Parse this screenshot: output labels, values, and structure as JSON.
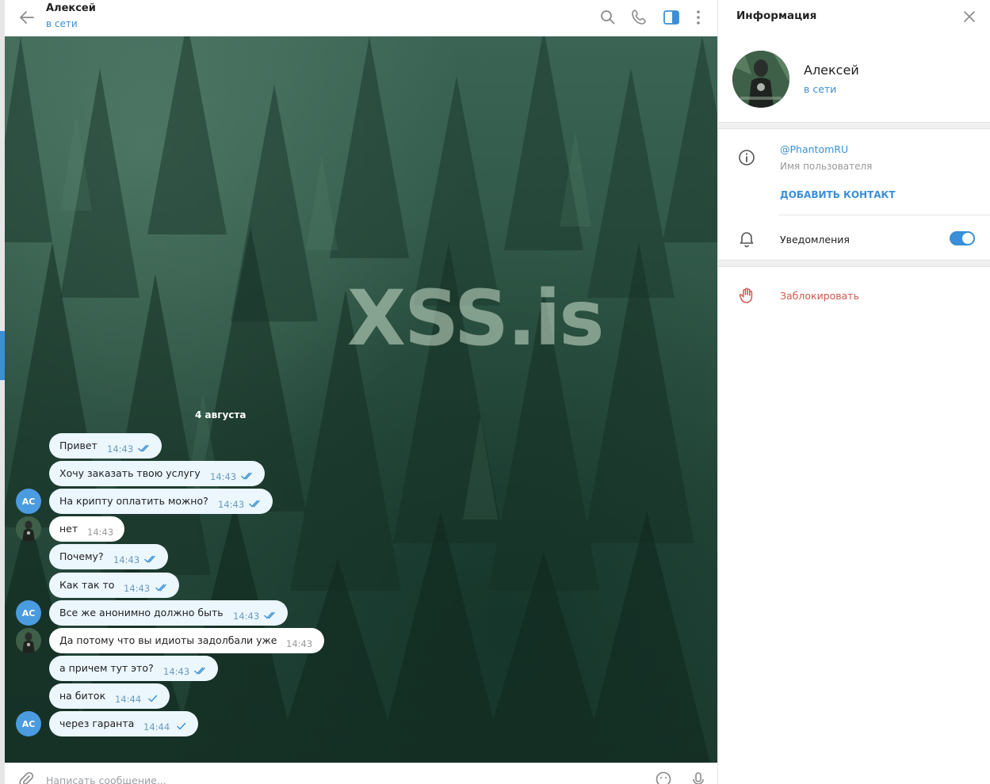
{
  "header": {
    "name": "Алексей",
    "status": "в сети"
  },
  "chat": {
    "watermark": "XSS.is",
    "date": "4 августа",
    "messages": [
      {
        "text": "Привет",
        "time": "14:43",
        "out": true,
        "check": "double",
        "avatar": ""
      },
      {
        "text": "Хочу заказать твою услугу",
        "time": "14:43",
        "out": true,
        "check": "double",
        "avatar": ""
      },
      {
        "text": "На крипту оплатить можно?",
        "time": "14:43",
        "out": true,
        "check": "double",
        "avatar": "АС"
      },
      {
        "text": "нет",
        "time": "14:43",
        "out": false,
        "check": "",
        "avatar": "photo"
      },
      {
        "text": "Почему?",
        "time": "14:43",
        "out": true,
        "check": "double",
        "avatar": ""
      },
      {
        "text": "Как так то",
        "time": "14:43",
        "out": true,
        "check": "double",
        "avatar": ""
      },
      {
        "text": "Все же анонимно должно быть",
        "time": "14:43",
        "out": true,
        "check": "double",
        "avatar": "АС"
      },
      {
        "text": "Да потому что вы идиоты задолбали уже",
        "time": "14:43",
        "out": false,
        "check": "",
        "avatar": "photo"
      },
      {
        "text": "а причем тут это?",
        "time": "14:43",
        "out": true,
        "check": "double",
        "avatar": ""
      },
      {
        "text": "на биток",
        "time": "14:44",
        "out": true,
        "check": "single",
        "avatar": ""
      },
      {
        "text": "через гаранта",
        "time": "14:44",
        "out": true,
        "check": "single",
        "avatar": "АС"
      }
    ]
  },
  "composer": {
    "placeholder": "Написать сообщение..."
  },
  "info": {
    "title": "Информация",
    "name": "Алексей",
    "status": "в сети",
    "username": "@PhantomRU",
    "username_label": "Имя пользователя",
    "add_contact": "ДОБАВИТЬ КОНТАКТ",
    "notifications": "Уведомления",
    "notifications_on": true,
    "block": "Заблокировать"
  },
  "colors": {
    "accent": "#3a8fd6",
    "danger": "#d2574d",
    "bubble_out": "#ebf6fd",
    "bubble_in": "#ffffff"
  }
}
